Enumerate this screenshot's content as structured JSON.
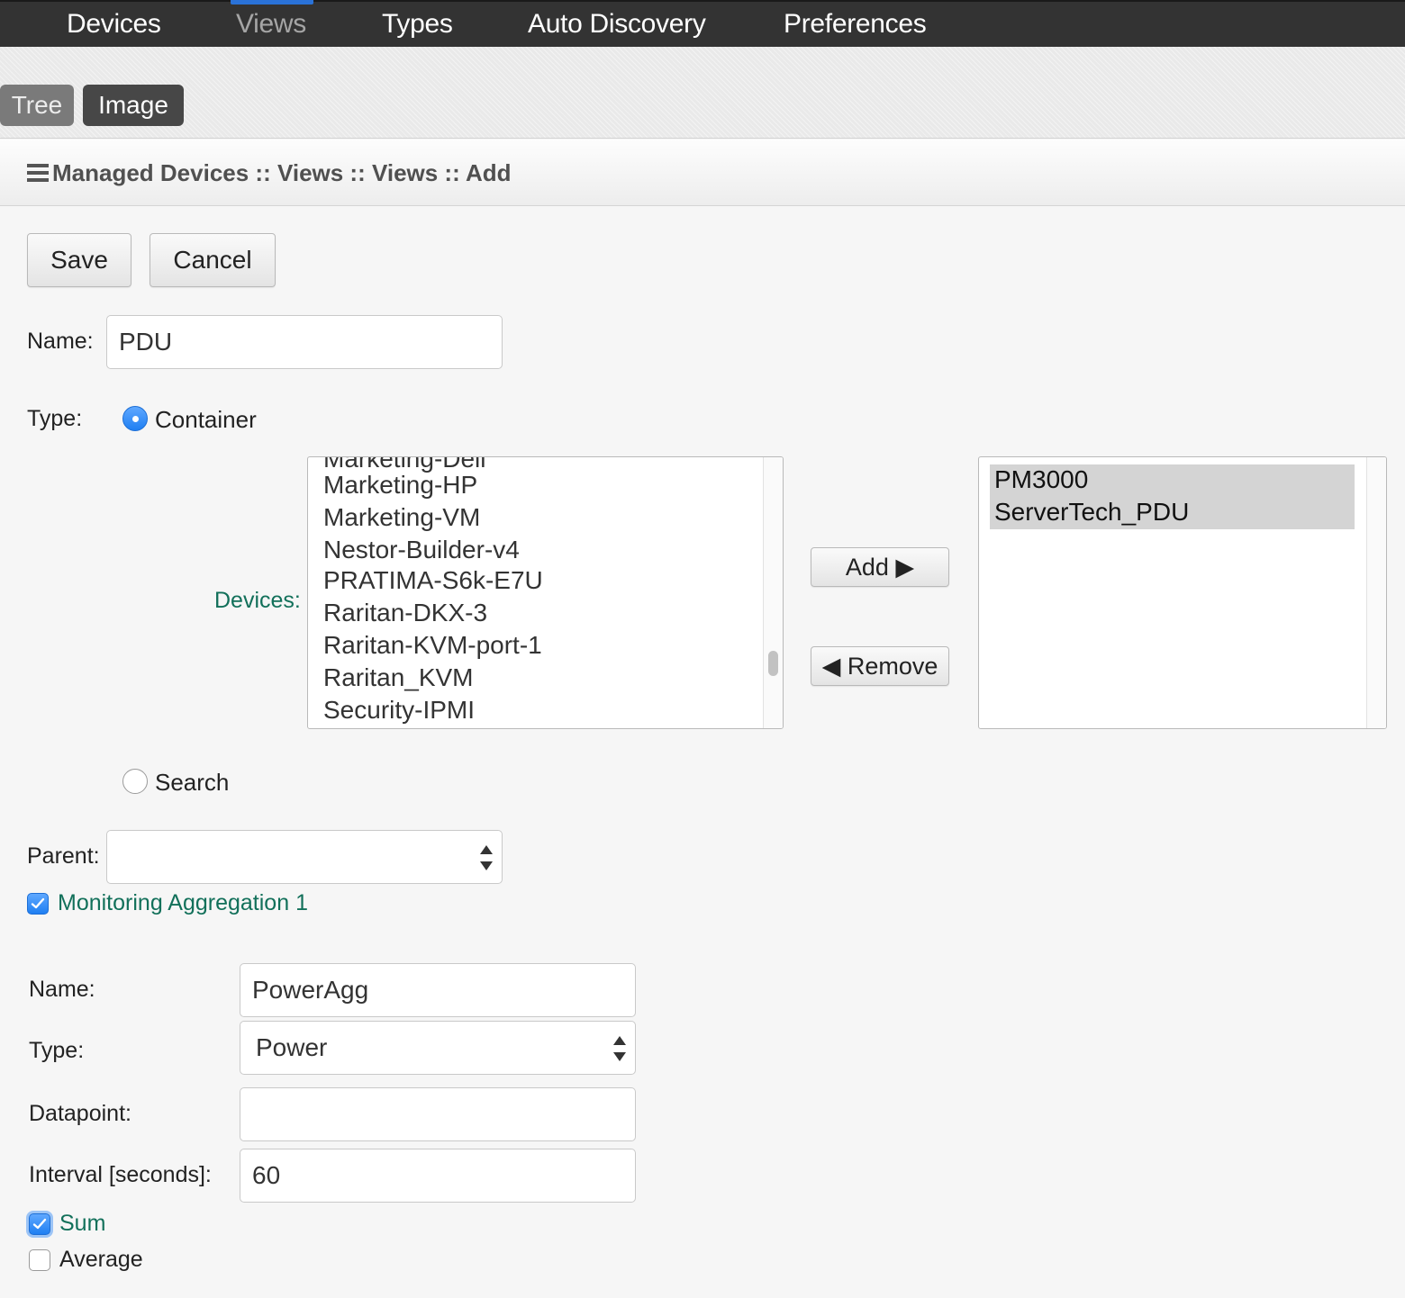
{
  "topnav": {
    "tabs": [
      {
        "label": "Devices"
      },
      {
        "label": "Views"
      },
      {
        "label": "Types"
      },
      {
        "label": "Auto Discovery"
      },
      {
        "label": "Preferences"
      }
    ],
    "active_tab": "Views"
  },
  "subbar": {
    "tree_label": "Tree",
    "image_label": "Image"
  },
  "breadcrumb": {
    "icon": "hamburger-menu-icon",
    "text": "Managed Devices :: Views :: Views :: Add"
  },
  "actions": {
    "save_label": "Save",
    "cancel_label": "Cancel"
  },
  "form": {
    "name_label": "Name:",
    "name_value": "PDU",
    "type_label": "Type:",
    "type_container_label": "Container",
    "type_search_label": "Search",
    "type_selected": "Container",
    "devices_label": "Devices:",
    "available_devices": [
      "Marketing-Dell",
      "Marketing-HP",
      "Marketing-VM",
      "Nestor-Builder-v4",
      "PRATIMA-S6k-E7U",
      "Raritan-DKX-3",
      "Raritan-KVM-port-1",
      "Raritan_KVM",
      "Security-IPMI"
    ],
    "add_label": "Add ▶",
    "remove_label": "◀ Remove",
    "selected_devices": [
      "PM3000",
      "ServerTech_PDU"
    ],
    "parent_label": "Parent:",
    "parent_value": ""
  },
  "aggregation": {
    "checkbox_label": "Monitoring Aggregation 1",
    "checked": true,
    "name_label": "Name:",
    "name_value": "PowerAgg",
    "type_label": "Type:",
    "type_value": "Power",
    "datapoint_label": "Datapoint:",
    "datapoint_value": "",
    "interval_label": "Interval [seconds]:",
    "interval_value": "60",
    "sum_label": "Sum",
    "sum_checked": true,
    "average_label": "Average",
    "average_checked": false
  },
  "colors": {
    "nav_background": "#333333",
    "active_tab_accent": "#2a72d8",
    "label_green": "#12705a",
    "checkbox_blue": "#1f7ff2"
  }
}
